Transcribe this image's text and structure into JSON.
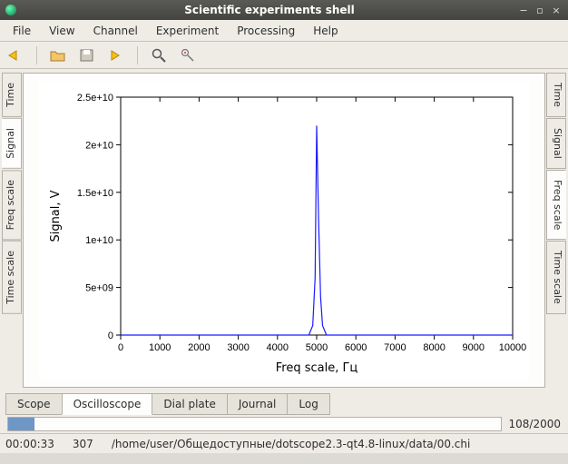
{
  "window": {
    "title": "Scientific experiments shell"
  },
  "menu": {
    "items": [
      "File",
      "View",
      "Channel",
      "Experiment",
      "Processing",
      "Help"
    ]
  },
  "toolbar": {
    "back": "back-icon",
    "open": "open-icon",
    "save": "save-icon",
    "forward": "forward-icon",
    "zoom": "zoom-icon",
    "measure": "measure-icon"
  },
  "left_tabs": [
    "Time",
    "Signal",
    "Freq scale",
    "Time scale"
  ],
  "left_active": "Signal",
  "right_tabs": [
    "Time",
    "Signal",
    "Freq scale",
    "Time scale"
  ],
  "right_active": "Freq scale",
  "bottom_tabs": [
    "Scope",
    "Oscilloscope",
    "Dial plate",
    "Journal",
    "Log"
  ],
  "bottom_active": "Oscilloscope",
  "progress": {
    "label": "108/2000",
    "current": 108,
    "total": 2000
  },
  "status": {
    "time": "00:00:33",
    "value": "307",
    "path": "/home/user/Общедоступные/dotscope2.3-qt4.8-linux/data/00.chi"
  },
  "chart_data": {
    "type": "line",
    "title": "",
    "xlabel": "Freq scale, Гц",
    "ylabel": "Signal, V",
    "xlim": [
      0,
      10000
    ],
    "ylim": [
      0,
      25000000000.0
    ],
    "xticks": [
      0,
      1000,
      2000,
      3000,
      4000,
      5000,
      6000,
      7000,
      8000,
      9000,
      10000
    ],
    "xtick_labels": [
      "0",
      "1000",
      "2000",
      "3000",
      "4000",
      "5000",
      "6000",
      "7000",
      "8000",
      "9000",
      "10000"
    ],
    "yticks": [
      0,
      5000000000.0,
      10000000000.0,
      15000000000.0,
      20000000000.0,
      25000000000.0
    ],
    "ytick_labels": [
      "0",
      "5e+09",
      "1e+10",
      "1.5e+10",
      "2e+10",
      "2.5e+10"
    ],
    "x": [
      0,
      4800,
      4900,
      4960,
      5000,
      5050,
      5100,
      5150,
      5250,
      10000
    ],
    "y": [
      0,
      0,
      1000000000.0,
      6000000000.0,
      22000000000.0,
      12000000000.0,
      4000000000.0,
      1000000000.0,
      0,
      0
    ]
  }
}
